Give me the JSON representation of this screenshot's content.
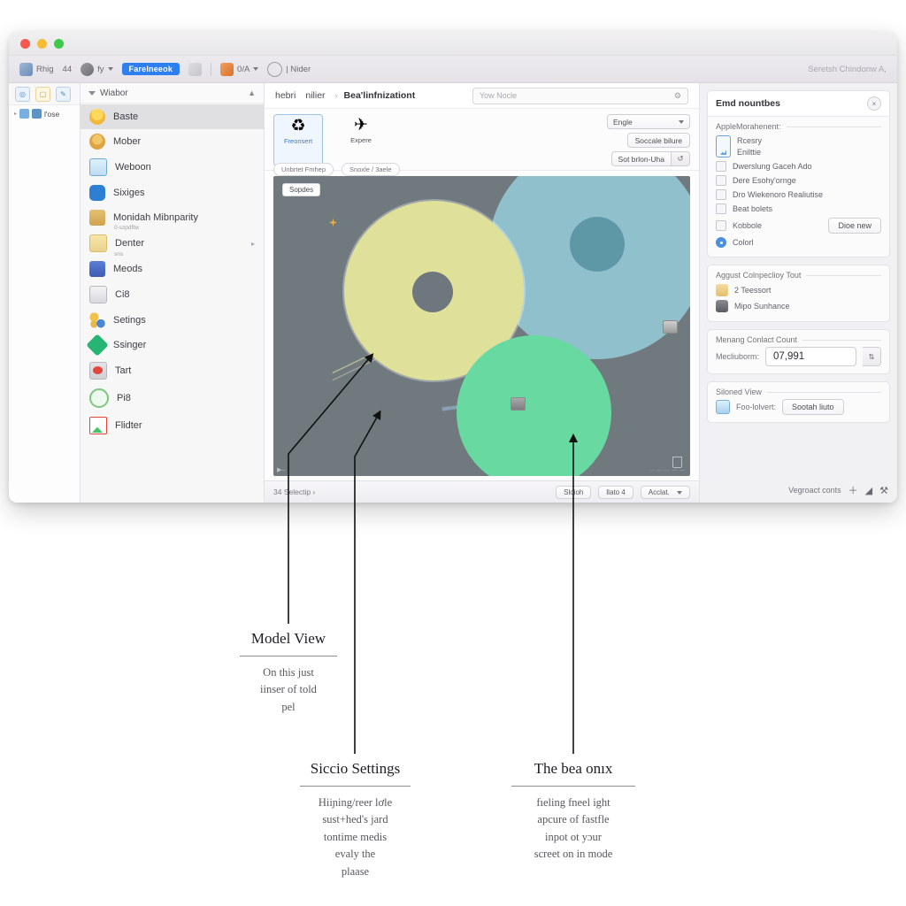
{
  "window": {
    "traffic_lights": [
      "close",
      "minimize",
      "zoom"
    ],
    "toolbar": {
      "items": [
        {
          "label": "Rhig",
          "icon": "app-icon"
        },
        {
          "label": "44",
          "icon": "text-label"
        },
        {
          "label": "fy",
          "icon": "globe-icon",
          "caret": true
        },
        {
          "label": "Farelneeok",
          "icon": "pill"
        },
        {
          "label": "",
          "icon": "window-icon"
        },
        {
          "label": "0/A",
          "icon": "orange-icon",
          "caret": true
        },
        {
          "label": "| Nider",
          "icon": "ring-icon"
        }
      ],
      "right_text": "Seretsh Chindonw A,"
    }
  },
  "tree_rail": {
    "tabs": [
      "project-icon",
      "notes-icon",
      "edit-icon"
    ],
    "root_label": "l'ose"
  },
  "sidebar": {
    "header": "Wiabor",
    "items": [
      {
        "label": "Baste",
        "icon": "bell-icon",
        "sub": "",
        "active": true,
        "arrow": false
      },
      {
        "label": "Mober",
        "icon": "person-icon",
        "sub": "",
        "active": false,
        "arrow": false
      },
      {
        "label": "Weboon",
        "icon": "mail-icon",
        "sub": "",
        "active": false,
        "arrow": false
      },
      {
        "label": "Sixiges",
        "icon": "blue-icon",
        "sub": "",
        "active": false,
        "arrow": false
      },
      {
        "label": "Monidah Mibnparity",
        "icon": "tan-picture-icon",
        "sub": "0-szpdfbx",
        "active": false,
        "arrow": false
      },
      {
        "label": "Denter",
        "icon": "folder-icon",
        "sub": "sns",
        "active": false,
        "arrow": true
      },
      {
        "label": "Meods",
        "icon": "cube-icon",
        "sub": "",
        "active": false,
        "arrow": false
      },
      {
        "label": "Ci8",
        "icon": "tower-icon",
        "sub": "",
        "active": false,
        "arrow": false
      },
      {
        "label": "Setings",
        "icon": "nodes-icon",
        "sub": "",
        "active": false,
        "arrow": false
      },
      {
        "label": "Ssinger",
        "icon": "diamond-icon",
        "sub": "",
        "active": false,
        "arrow": false
      },
      {
        "label": "Tart",
        "icon": "photo-icon",
        "sub": "",
        "active": false,
        "arrow": false
      },
      {
        "label": "Pi8",
        "icon": "target-icon",
        "sub": "",
        "active": false,
        "arrow": false
      },
      {
        "label": "Flidter",
        "icon": "mail-m-icon",
        "sub": "",
        "active": false,
        "arrow": false
      }
    ]
  },
  "editor": {
    "breadcrumb": {
      "first": "hebri",
      "highlight": "nilier",
      "separator": "›",
      "current": "Bea'linfnizationt"
    },
    "search": {
      "placeholder": "Yow Nocle",
      "icon": "settings-slider-icon"
    },
    "tools": [
      {
        "label": "Freonsert",
        "glyph": "♻",
        "selected": true
      },
      {
        "label": "Expere",
        "glyph": "✈",
        "selected": false
      }
    ],
    "chips": [
      "Unbrtet Fmhep",
      "Snoxle / 3aele"
    ],
    "viewport_controls": {
      "select_value": "Engle",
      "button_label": "Soccale bilure",
      "split_label": "Sot brlon-Uha",
      "split_icon": "↺"
    },
    "viewport": {
      "badge": "Sopdes",
      "bottom_left": "▶‒",
      "watermark": "— — — — —",
      "background_color": "#70797e",
      "shapes": [
        {
          "name": "yellow-disc",
          "color": "#dfe19a"
        },
        {
          "name": "blue-disc",
          "color": "#8fc0cc"
        },
        {
          "name": "green-disc",
          "color": "#68d9a0"
        },
        {
          "name": "yellow-core",
          "color": "#6e777d"
        },
        {
          "name": "blue-core",
          "color": "#5e97a6"
        }
      ]
    },
    "statusbar": {
      "left": "34  Selectip ›",
      "buttons": [
        "Sloioh",
        "llato 4"
      ],
      "dropdown": "Acclat."
    }
  },
  "inspector": {
    "panel1": {
      "title": "Emd nountbes",
      "close_icon": "×",
      "group_label": "AppleMorahenent:",
      "phone_lines": [
        "Rcesry",
        "Enilttie"
      ],
      "checkboxes": [
        {
          "label": "Dwerslung Gaceh Ado",
          "checked": false
        },
        {
          "label": "Dere Esohy'ornge",
          "checked": false
        },
        {
          "label": "Dro Wiekenoro Realiutise",
          "checked": false
        },
        {
          "label": "Beat bolets",
          "checked": false
        },
        {
          "label": "Kobbole",
          "checked": false
        }
      ],
      "radio": {
        "label": "Colorl",
        "selected": true
      },
      "button": "Dioe new"
    },
    "panel2": {
      "title": "Aggust Colnpeclioy Tout",
      "rows": [
        {
          "label": "2 Teessort",
          "icon": "person-icon"
        },
        {
          "label": "Mipo Sunhance",
          "icon": "dark-icon"
        }
      ]
    },
    "panel3": {
      "title": "Menang Conlact Count",
      "field_label": "Mecliuborm:",
      "value": "07,991",
      "stepper_icon": "⇅"
    },
    "panel4": {
      "title": "Siloned View",
      "row_label": "Foo-lolvert:",
      "row_icon": "blue-icon",
      "button": "Sootah liuto"
    },
    "footer": {
      "label": "Vegroact conts",
      "icons": [
        "plus-icon",
        "chart-icon",
        "wrench-icon"
      ],
      "glyphs": [
        "＋",
        "◢",
        "⚒"
      ]
    }
  },
  "callouts": [
    {
      "title": "Model View",
      "body": "On this just\niinser of told\npel"
    },
    {
      "title": "Siccio Settings",
      "body": "Hiiɲing/reer lơle\nsust+hed's jard\ntontime medis\nevaly the\nplaase"
    },
    {
      "title": "The bea onıx",
      "body": "fıeling fneel ight\napcure of fastfle\ninpot ot yɔur\nscreet on in mode"
    }
  ]
}
